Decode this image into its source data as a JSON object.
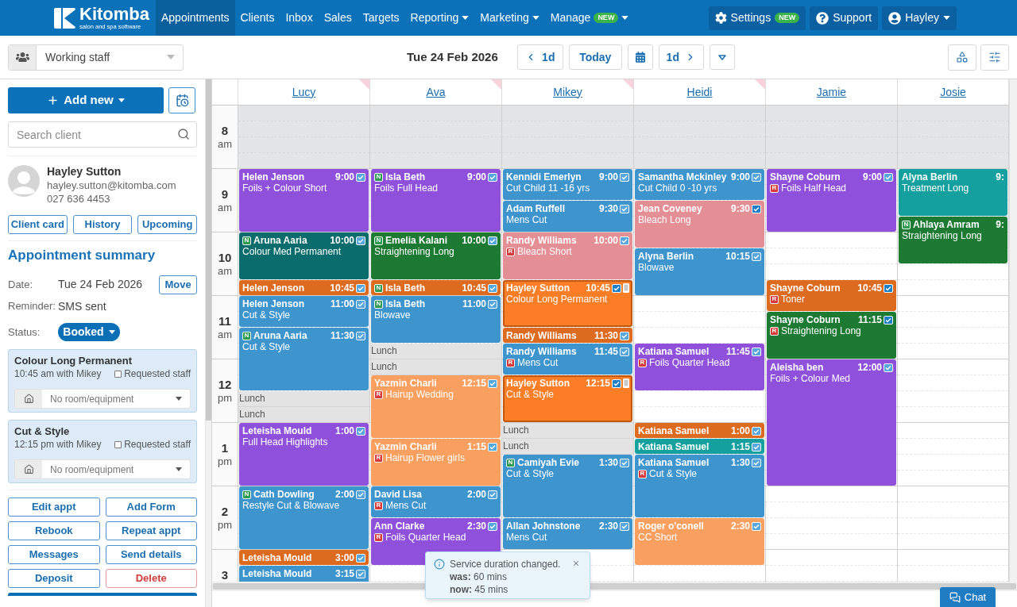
{
  "nav": {
    "brand": "Kitomba",
    "tagline": "salon and spa software",
    "items": [
      {
        "label": "Appointments",
        "selected": true,
        "dropdown": false
      },
      {
        "label": "Clients",
        "selected": false,
        "dropdown": false
      },
      {
        "label": "Inbox",
        "selected": false,
        "dropdown": false
      },
      {
        "label": "Sales",
        "selected": false,
        "dropdown": false
      },
      {
        "label": "Targets",
        "selected": false,
        "dropdown": false
      },
      {
        "label": "Reporting",
        "selected": false,
        "dropdown": true
      },
      {
        "label": "Marketing",
        "selected": false,
        "dropdown": true
      },
      {
        "label": "Manage",
        "badge": "NEW",
        "selected": false,
        "dropdown": true
      }
    ],
    "actions": [
      {
        "kind": "settings",
        "label": "Settings",
        "badge": "NEW",
        "dropdown": false
      },
      {
        "kind": "support",
        "label": "Support",
        "dropdown": false
      },
      {
        "kind": "account",
        "label": "Hayley",
        "dropdown": true
      }
    ]
  },
  "toolbar": {
    "staff_filter": {
      "value": "Working staff"
    },
    "date": "Tue 24 Feb 2026",
    "prev": "1d",
    "today": "Today",
    "next": "1d"
  },
  "sidebar": {
    "add_new": "Add new",
    "search": {
      "placeholder": "Search client"
    },
    "client": {
      "name": "Hayley Sutton",
      "email": "hayley.sutton@kitomba.com",
      "phone": "027 636 4453"
    },
    "client_buttons": [
      "Client card",
      "History",
      "Upcoming"
    ],
    "summary": {
      "title": "Appointment summary",
      "date": {
        "label": "Date:",
        "value": "Tue 24 Feb 2026"
      },
      "move": "Move",
      "reminder": {
        "label": "Reminder:",
        "value": "SMS sent"
      },
      "status": {
        "label": "Status:",
        "value": "Booked"
      }
    },
    "services": [
      {
        "name": "Colour Long Permanent",
        "detail": "10:45 am with Mikey",
        "requested_staff": {
          "label": "Requested staff",
          "checked": false
        },
        "room": {
          "placeholder": "No room/equipment"
        }
      },
      {
        "name": "Cut & Style",
        "detail": "12:15 pm with Mikey",
        "requested_staff": {
          "label": "Requested staff",
          "checked": false
        },
        "room": {
          "placeholder": "No room/equipment"
        }
      }
    ],
    "actions": [
      {
        "label": "Edit appt",
        "kind": "default"
      },
      {
        "label": "Add Form",
        "kind": "default"
      },
      {
        "label": "Rebook",
        "kind": "default"
      },
      {
        "label": "Repeat appt",
        "kind": "default"
      },
      {
        "label": "Messages",
        "kind": "default"
      },
      {
        "label": "Send details",
        "kind": "default"
      },
      {
        "label": "Deposit",
        "kind": "default"
      },
      {
        "label": "Delete",
        "kind": "danger"
      }
    ]
  },
  "calendar": {
    "hours": [
      {
        "hour": "8",
        "period": "am",
        "closed": true
      },
      {
        "hour": "9",
        "period": "am",
        "closed": false
      },
      {
        "hour": "10",
        "period": "am",
        "closed": false
      },
      {
        "hour": "11",
        "period": "am",
        "closed": false
      },
      {
        "hour": "12",
        "period": "pm",
        "closed": false
      },
      {
        "hour": "1",
        "period": "pm",
        "closed": false
      },
      {
        "hour": "2",
        "period": "pm",
        "closed": false
      },
      {
        "hour": "3",
        "closed": false
      }
    ],
    "staff": [
      {
        "name": "Lucy",
        "flagged": true,
        "slots": [
          {
            "kind": "free"
          },
          {
            "kind": "free"
          },
          {
            "kind": "free"
          },
          {
            "kind": "free"
          },
          {
            "kind": "appointment",
            "client": "Helen Jenson",
            "time": "9:00",
            "service": "Foils + Colour Short",
            "color": "#8f50dc",
            "selected": false,
            "confirmed": true,
            "icon_filled": false,
            "mobile": false
          },
          {
            "kind": "continued"
          },
          {
            "kind": "continued"
          },
          {
            "kind": "continued"
          },
          {
            "kind": "appointment",
            "client_tag": "N",
            "client": "Aruna Aaria",
            "time": "10:00",
            "service": "Colour Med Permanent",
            "color": "#0a6c6c",
            "selected": false,
            "confirmed": true,
            "icon_filled": false,
            "mobile": false
          },
          {
            "kind": "continued"
          },
          {
            "kind": "continued"
          },
          {
            "kind": "appointment",
            "client": "Helen Jenson",
            "time": "10:45",
            "color": "#dc6b20",
            "selected": false,
            "confirmed": true,
            "icon_filled": false,
            "mobile": false
          },
          {
            "kind": "appointment",
            "client": "Helen Jenson",
            "time": "11:00",
            "service": "Cut & Style",
            "color": "#3e95cd",
            "selected": false,
            "confirmed": true,
            "icon_filled": false,
            "mobile": false
          },
          {
            "kind": "continued"
          },
          {
            "kind": "appointment",
            "client_tag": "N",
            "client": "Aruna Aaria",
            "time": "11:30",
            "service": "Cut & Style",
            "color": "#3e95cd",
            "selected": false,
            "confirmed": true,
            "icon_filled": false,
            "mobile": false
          },
          {
            "kind": "continued"
          },
          {
            "kind": "continued"
          },
          {
            "kind": "continued"
          },
          {
            "kind": "break",
            "label": "Lunch"
          },
          {
            "kind": "break",
            "label": "Lunch"
          },
          {
            "kind": "appointment",
            "client": "Leteisha Mould",
            "time": "1:00",
            "service": "Full Head Highlights",
            "color": "#8f50dc",
            "selected": false,
            "confirmed": true,
            "icon_filled": false,
            "mobile": false
          },
          {
            "kind": "continued"
          },
          {
            "kind": "continued"
          },
          {
            "kind": "continued"
          },
          {
            "kind": "appointment",
            "client_tag": "N",
            "client": "Cath Dowling",
            "time": "2:00",
            "service": "Restyle Cut & Blowave",
            "color": "#3e95cd",
            "selected": false,
            "confirmed": true,
            "icon_filled": false,
            "mobile": false
          },
          {
            "kind": "continued"
          },
          {
            "kind": "continued"
          },
          {
            "kind": "continued"
          },
          {
            "kind": "appointment",
            "client": "Leteisha Mould",
            "time": "3:00",
            "color": "#dc6b20",
            "selected": false,
            "confirmed": true,
            "icon_filled": false,
            "mobile": false
          },
          {
            "kind": "appointment",
            "client": "Leteisha Mould",
            "time": "3:15",
            "color": "#3e95cd",
            "selected": false,
            "confirmed": true,
            "icon_filled": false,
            "mobile": false
          },
          {
            "kind": "continued"
          },
          {
            "kind": "continued"
          }
        ]
      },
      {
        "name": "Ava",
        "flagged": true,
        "slots": [
          {
            "kind": "free"
          },
          {
            "kind": "free"
          },
          {
            "kind": "free"
          },
          {
            "kind": "free"
          },
          {
            "kind": "appointment",
            "client_tag": "N",
            "client": "Isla Beth",
            "time": "9:00",
            "service": "Foils Full Head",
            "color": "#8f50dc",
            "selected": false,
            "confirmed": true,
            "icon_filled": false,
            "mobile": false
          },
          {
            "kind": "continued"
          },
          {
            "kind": "continued"
          },
          {
            "kind": "continued"
          },
          {
            "kind": "appointment",
            "client_tag": "N",
            "client": "Emelia Kalani",
            "time": "10:00",
            "service": "Straightening Long",
            "color": "#1d7a33",
            "selected": false,
            "confirmed": true,
            "icon_filled": false,
            "mobile": false
          },
          {
            "kind": "continued"
          },
          {
            "kind": "continued"
          },
          {
            "kind": "appointment",
            "client_tag": "N",
            "client": "Isla Beth",
            "time": "10:45",
            "color": "#dc6b20",
            "selected": false,
            "confirmed": true,
            "icon_filled": false,
            "mobile": false
          },
          {
            "kind": "appointment",
            "client_tag": "N",
            "client": "Isla Beth",
            "time": "11:00",
            "service": "Blowave",
            "color": "#3e95cd",
            "selected": false,
            "confirmed": true,
            "icon_filled": false,
            "mobile": false
          },
          {
            "kind": "continued"
          },
          {
            "kind": "continued"
          },
          {
            "kind": "break",
            "label": "Lunch"
          },
          {
            "kind": "break",
            "label": "Lunch"
          },
          {
            "kind": "appointment",
            "client": "Yazmin Charli",
            "time": "12:15",
            "service_tag": "R",
            "service": "Hairup Wedding",
            "color": "#f9a061",
            "selected": false,
            "confirmed": true,
            "icon_filled": false,
            "mobile": false
          },
          {
            "kind": "continued"
          },
          {
            "kind": "continued"
          },
          {
            "kind": "continued"
          },
          {
            "kind": "appointment",
            "client": "Yazmin Charli",
            "time": "1:15",
            "service_tag": "R",
            "service": "Hairup Flower girls",
            "color": "#f9a061",
            "selected": false,
            "confirmed": true,
            "icon_filled": false,
            "mobile": false
          },
          {
            "kind": "continued"
          },
          {
            "kind": "continued"
          },
          {
            "kind": "appointment",
            "client": "David Lisa",
            "time": "2:00",
            "service_tag": "R",
            "service": "Mens Cut",
            "color": "#3e95cd",
            "selected": false,
            "confirmed": true,
            "icon_filled": false,
            "mobile": false
          },
          {
            "kind": "continued"
          },
          {
            "kind": "appointment",
            "client": "Ann Clarke",
            "time": "2:30",
            "service_tag": "R",
            "service": "Foils Quarter Head",
            "color": "#8f50dc",
            "selected": false,
            "confirmed": true,
            "icon_filled": false,
            "mobile": false
          },
          {
            "kind": "continued"
          },
          {
            "kind": "continued"
          }
        ]
      },
      {
        "name": "Mikey",
        "flagged": true,
        "slots": [
          {
            "kind": "free"
          },
          {
            "kind": "free"
          },
          {
            "kind": "free"
          },
          {
            "kind": "free"
          },
          {
            "kind": "appointment",
            "client": "Kennidi Emerlyn",
            "time": "9:00",
            "service": "Cut Child 11 -16 yrs",
            "color": "#3e95cd",
            "selected": false,
            "confirmed": true,
            "icon_filled": false,
            "mobile": false
          },
          {
            "kind": "continued"
          },
          {
            "kind": "appointment",
            "client": "Adam Ruffell",
            "time": "9:30",
            "service": "Mens Cut",
            "color": "#3e95cd",
            "selected": false,
            "confirmed": true,
            "icon_filled": false,
            "mobile": false
          },
          {
            "kind": "continued"
          },
          {
            "kind": "appointment",
            "client": "Randy Williams",
            "time": "10:00",
            "service_tag": "R",
            "service": "Bleach Short",
            "color": "#e48f95",
            "selected": false,
            "confirmed": true,
            "icon_filled": false,
            "mobile": false
          },
          {
            "kind": "continued"
          },
          {
            "kind": "continued"
          },
          {
            "kind": "appointment",
            "client": "Hayley Sutton",
            "time": "10:45",
            "service": "Colour Long Permanent",
            "color": "#fb7e26",
            "selected": true,
            "confirmed": true,
            "icon_filled": true,
            "mobile": true
          },
          {
            "kind": "continued"
          },
          {
            "kind": "continued"
          },
          {
            "kind": "appointment",
            "client": "Randy Williams",
            "time": "11:30",
            "color": "#dc6b20",
            "selected": false,
            "confirmed": true,
            "icon_filled": false,
            "mobile": false
          },
          {
            "kind": "appointment",
            "client": "Randy Williams",
            "time": "11:45",
            "service_tag": "R",
            "service": "Mens Cut",
            "color": "#3e95cd",
            "selected": false,
            "confirmed": true,
            "icon_filled": false,
            "mobile": false
          },
          {
            "kind": "continued"
          },
          {
            "kind": "appointment",
            "client": "Hayley Sutton",
            "time": "12:15",
            "service": "Cut & Style",
            "color": "#fb7e26",
            "selected": true,
            "confirmed": true,
            "icon_filled": true,
            "mobile": true
          },
          {
            "kind": "continued"
          },
          {
            "kind": "continued"
          },
          {
            "kind": "break",
            "label": "Lunch"
          },
          {
            "kind": "break",
            "label": "Lunch"
          },
          {
            "kind": "appointment",
            "client_tag": "N",
            "client": "Camiyah Evie",
            "time": "1:30",
            "service": "Cut & Style",
            "color": "#3e95cd",
            "selected": false,
            "confirmed": true,
            "icon_filled": false,
            "mobile": false
          },
          {
            "kind": "continued"
          },
          {
            "kind": "continued"
          },
          {
            "kind": "continued"
          },
          {
            "kind": "appointment",
            "client": "Allan Johnstone",
            "time": "2:30",
            "service": "Mens Cut",
            "color": "#3e95cd",
            "selected": false,
            "confirmed": true,
            "icon_filled": false,
            "mobile": false
          },
          {
            "kind": "continued"
          }
        ]
      },
      {
        "name": "Heidi",
        "flagged": true,
        "slots": [
          {
            "kind": "free"
          },
          {
            "kind": "free"
          },
          {
            "kind": "free"
          },
          {
            "kind": "free"
          },
          {
            "kind": "appointment",
            "client": "Samantha Mckinley",
            "time": "9:00",
            "service": "Cut Child 0 -10 yrs",
            "color": "#3e95cd",
            "selected": false,
            "confirmed": true,
            "icon_filled": false,
            "mobile": false
          },
          {
            "kind": "continued"
          },
          {
            "kind": "appointment",
            "client": "Jean Coveney",
            "time": "9:30",
            "service": "Bleach Long",
            "color": "#e48f95",
            "selected": false,
            "confirmed": true,
            "icon_filled": true,
            "mobile": false
          },
          {
            "kind": "continued"
          },
          {
            "kind": "continued"
          },
          {
            "kind": "appointment",
            "client": "Alyna Berlin",
            "time": "10:15",
            "service": "Blowave",
            "color": "#3e95cd",
            "selected": false,
            "confirmed": true,
            "icon_filled": false,
            "mobile": false
          },
          {
            "kind": "continued"
          },
          {
            "kind": "continued"
          },
          {
            "kind": "free"
          },
          {
            "kind": "free"
          },
          {
            "kind": "free"
          },
          {
            "kind": "appointment",
            "client": "Katiana Samuel",
            "time": "11:45",
            "service_tag": "R",
            "service": "Foils Quarter Head",
            "color": "#8f50dc",
            "selected": false,
            "confirmed": true,
            "icon_filled": false,
            "mobile": false
          },
          {
            "kind": "continued"
          },
          {
            "kind": "continued"
          },
          {
            "kind": "free"
          },
          {
            "kind": "free"
          },
          {
            "kind": "appointment",
            "client": "Katiana Samuel",
            "time": "1:00",
            "color": "#dc6b20",
            "selected": false,
            "confirmed": true,
            "icon_filled": false,
            "mobile": false
          },
          {
            "kind": "appointment",
            "client": "Katiana Samuel",
            "time": "1:15",
            "color": "#13a09f",
            "selected": false,
            "confirmed": true,
            "icon_filled": false,
            "mobile": false
          },
          {
            "kind": "appointment",
            "client": "Katiana Samuel",
            "time": "1:30",
            "service_tag": "R",
            "service": "Cut & Style",
            "color": "#3e95cd",
            "selected": false,
            "confirmed": true,
            "icon_filled": false,
            "mobile": false
          },
          {
            "kind": "continued"
          },
          {
            "kind": "continued"
          },
          {
            "kind": "continued"
          },
          {
            "kind": "appointment",
            "client": "Roger o'conell",
            "time": "2:30",
            "service": "CC Short",
            "color": "#f9a061",
            "selected": false,
            "confirmed": true,
            "icon_filled": false,
            "mobile": false
          },
          {
            "kind": "continued"
          },
          {
            "kind": "continued"
          }
        ]
      },
      {
        "name": "Jamie",
        "flagged": false,
        "slots": [
          {
            "kind": "free"
          },
          {
            "kind": "free"
          },
          {
            "kind": "free"
          },
          {
            "kind": "free"
          },
          {
            "kind": "appointment",
            "client": "Shayne Coburn",
            "time": "9:00",
            "service_tag": "R",
            "service": "Foils Half Head",
            "color": "#8f50dc",
            "selected": false,
            "confirmed": true,
            "icon_filled": false,
            "mobile": false
          },
          {
            "kind": "continued"
          },
          {
            "kind": "continued"
          },
          {
            "kind": "continued"
          },
          {
            "kind": "free"
          },
          {
            "kind": "free"
          },
          {
            "kind": "free"
          },
          {
            "kind": "appointment",
            "client": "Shayne Coburn",
            "time": "10:45",
            "service_tag": "R",
            "service": "Toner",
            "color": "#dc6b20",
            "selected": false,
            "confirmed": true,
            "icon_filled": true,
            "mobile": false
          },
          {
            "kind": "continued"
          },
          {
            "kind": "appointment",
            "client": "Shayne Coburn",
            "time": "11:15",
            "service_tag": "R",
            "service": "Straightening Long",
            "color": "#1d7a33",
            "selected": false,
            "confirmed": true,
            "icon_filled": true,
            "mobile": false
          },
          {
            "kind": "continued"
          },
          {
            "kind": "continued"
          },
          {
            "kind": "appointment",
            "client": "Aleisha ben",
            "time": "12:00",
            "service": "Foils + Colour Med",
            "color": "#8f50dc",
            "selected": false,
            "confirmed": true,
            "icon_filled": false,
            "mobile": false
          },
          {
            "kind": "continued"
          },
          {
            "kind": "continued"
          },
          {
            "kind": "continued"
          },
          {
            "kind": "continued"
          },
          {
            "kind": "continued"
          },
          {
            "kind": "continued"
          },
          {
            "kind": "continued"
          }
        ]
      },
      {
        "name": "Josie",
        "flagged": false,
        "slots": [
          {
            "kind": "free"
          },
          {
            "kind": "free"
          },
          {
            "kind": "free"
          },
          {
            "kind": "free"
          },
          {
            "kind": "appointment",
            "client": "Alyna Berlin",
            "time": "9:",
            "service": "Treatment Long",
            "color": "#13a09f",
            "selected": false,
            "confirmed": false,
            "mobile": false
          },
          {
            "kind": "continued"
          },
          {
            "kind": "continued"
          },
          {
            "kind": "appointment",
            "client_tag": "N",
            "client": "Ahlaya Amram",
            "time": "9:",
            "service": "Straightening Long",
            "color": "#1d7a33",
            "selected": false,
            "confirmed": false,
            "mobile": false
          },
          {
            "kind": "continued"
          },
          {
            "kind": "continued"
          }
        ]
      }
    ]
  },
  "toast": {
    "message": "Service duration changed.",
    "lines": [
      "**was:** 60 mins",
      "**now:** 45 mins"
    ]
  },
  "chat": {
    "label": "Chat"
  }
}
